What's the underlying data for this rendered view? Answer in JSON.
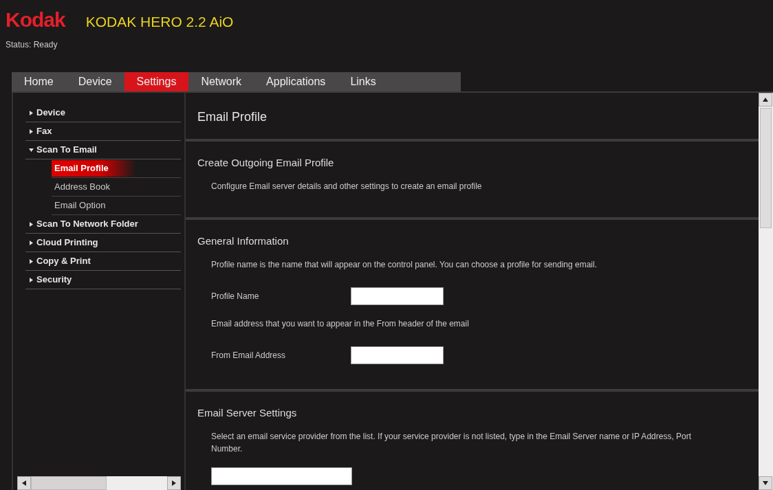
{
  "header": {
    "logo": "Kodak",
    "title": "KODAK HERO 2.2 AiO",
    "status": "Status: Ready"
  },
  "tabs": [
    {
      "label": "Home",
      "selected": false
    },
    {
      "label": "Device",
      "selected": false
    },
    {
      "label": "Settings",
      "selected": true
    },
    {
      "label": "Network",
      "selected": false
    },
    {
      "label": "Applications",
      "selected": false
    },
    {
      "label": "Links",
      "selected": false
    }
  ],
  "sidebar": {
    "items": [
      {
        "label": "Device",
        "expanded": false,
        "selected": false
      },
      {
        "label": "Fax",
        "expanded": false,
        "selected": false
      },
      {
        "label": "Scan To Email",
        "expanded": true,
        "selected": false,
        "children": [
          {
            "label": "Email Profile",
            "selected": true
          },
          {
            "label": "Address Book",
            "selected": false
          },
          {
            "label": "Email Option",
            "selected": false
          }
        ]
      },
      {
        "label": "Scan To Network Folder",
        "expanded": false,
        "selected": false
      },
      {
        "label": "Cloud Printing",
        "expanded": false,
        "selected": false
      },
      {
        "label": "Copy & Print",
        "expanded": false,
        "selected": false
      },
      {
        "label": "Security",
        "expanded": false,
        "selected": false
      }
    ]
  },
  "page_title": "Email Profile",
  "sections": [
    {
      "title": "Create Outgoing Email Profile",
      "blocks": [
        {
          "kind": "text",
          "text": "Configure Email server details and other settings to create an email profile"
        }
      ]
    },
    {
      "title": "General Information",
      "blocks": [
        {
          "kind": "text",
          "text": "Profile name is the name that will appear on the control panel. You can choose a profile for sending email."
        },
        {
          "kind": "field",
          "label": "Profile Name"
        },
        {
          "kind": "text",
          "text": "Email address that you want to appear in the From header of the email"
        },
        {
          "kind": "field",
          "label": "From Email Address"
        }
      ]
    },
    {
      "title": "Email Server Settings",
      "blocks": [
        {
          "kind": "text",
          "text": "Select an email service provider from the list. If your service provider is not listed, type in the Email Server name or IP Address, Port Number."
        },
        {
          "kind": "select"
        }
      ]
    }
  ]
}
